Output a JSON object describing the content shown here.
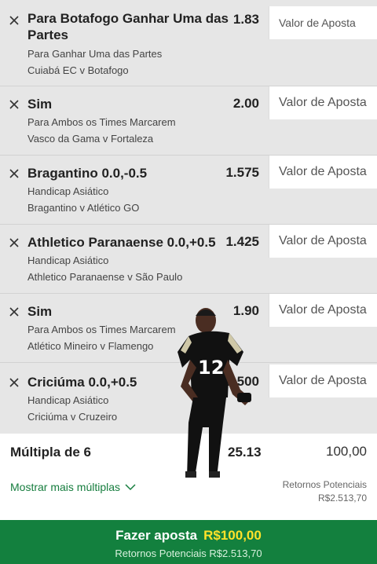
{
  "bets": [
    {
      "selection_line1": "Para Botafogo Ganhar Uma das",
      "selection_line2": "Partes",
      "odds": "1.83",
      "market": "Para Ganhar Uma das Partes",
      "match": "Cuiabá EC v Botafogo",
      "stake_placeholder": "Valor de Aposta"
    },
    {
      "selection_line1": "Sim",
      "odds": "2.00",
      "market": "Para Ambos os Times Marcarem",
      "match": "Vasco da Gama v Fortaleza",
      "stake_placeholder": "Valor de Aposta"
    },
    {
      "selection_line1": "Bragantino 0.0,-0.5",
      "odds": "1.575",
      "market": "Handicap Asiático",
      "match": "Bragantino v Atlético GO",
      "stake_placeholder": "Valor de Aposta"
    },
    {
      "selection_line1": "Athletico Paranaense 0.0,+0.5",
      "odds": "1.425",
      "market": "Handicap Asiático",
      "match": "Athletico Paranaense v São Paulo",
      "stake_placeholder": "Valor de Aposta"
    },
    {
      "selection_line1": "Sim",
      "odds": "1.90",
      "market": "Para Ambos os Times Marcarem",
      "match": "Atlético Mineiro v Flamengo",
      "stake_placeholder": "Valor de Aposta"
    },
    {
      "selection_line1": "Criciúma 0.0,+0.5",
      "odds": "1.500",
      "market": "Handicap Asiático",
      "match": "Criciúma v Cruzeiro",
      "stake_placeholder": "Valor de Aposta"
    }
  ],
  "multiple": {
    "label": "Múltipla de 6",
    "odds": "25.13",
    "stake": "100,00",
    "more_label": "Mostrar mais múltiplas",
    "returns_label": "Retornos Potenciais",
    "returns_value": "R$2.513,70"
  },
  "place_bet": {
    "label": "Fazer aposta",
    "amount": "R$100,00",
    "returns": "Retornos Potenciais R$2.513,70"
  },
  "colors": {
    "brand_green": "#13803e",
    "amount_yellow": "#ffe22a",
    "link_green": "#167d3e"
  },
  "overlay": {
    "jersey_number": "12"
  }
}
